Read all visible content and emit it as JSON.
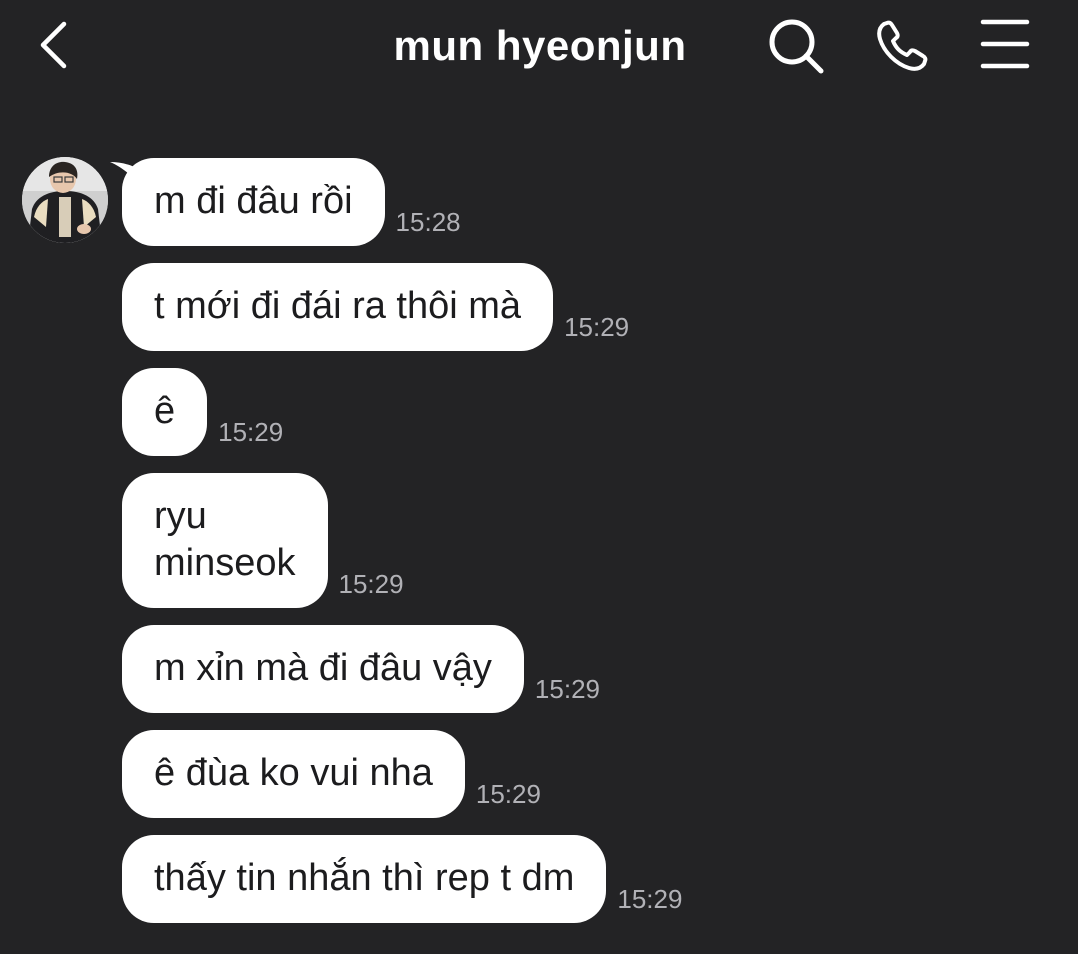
{
  "header": {
    "title": "mun hyeonjun",
    "back_icon": "chevron-left-icon",
    "search_icon": "search-icon",
    "call_icon": "phone-icon",
    "menu_icon": "menu-icon"
  },
  "colors": {
    "background": "#232325",
    "bubble": "#ffffff",
    "bubble_text": "#1c1c1e",
    "timestamp": "#b1b1b6",
    "header_text": "#ffffff"
  },
  "messages": [
    {
      "text": "m đi đâu rồi",
      "time": "15:28"
    },
    {
      "text": "t mới đi đái ra thôi mà",
      "time": "15:29"
    },
    {
      "text": "ê",
      "time": "15:29"
    },
    {
      "lines": [
        "ryu",
        "minseok"
      ],
      "time": "15:29"
    },
    {
      "text": "m xỉn mà đi đâu vậy",
      "time": "15:29"
    },
    {
      "text": "ê đùa ko vui nha",
      "time": "15:29"
    },
    {
      "text": "thấy tin nhắn thì rep t dm",
      "time": "15:29"
    }
  ]
}
